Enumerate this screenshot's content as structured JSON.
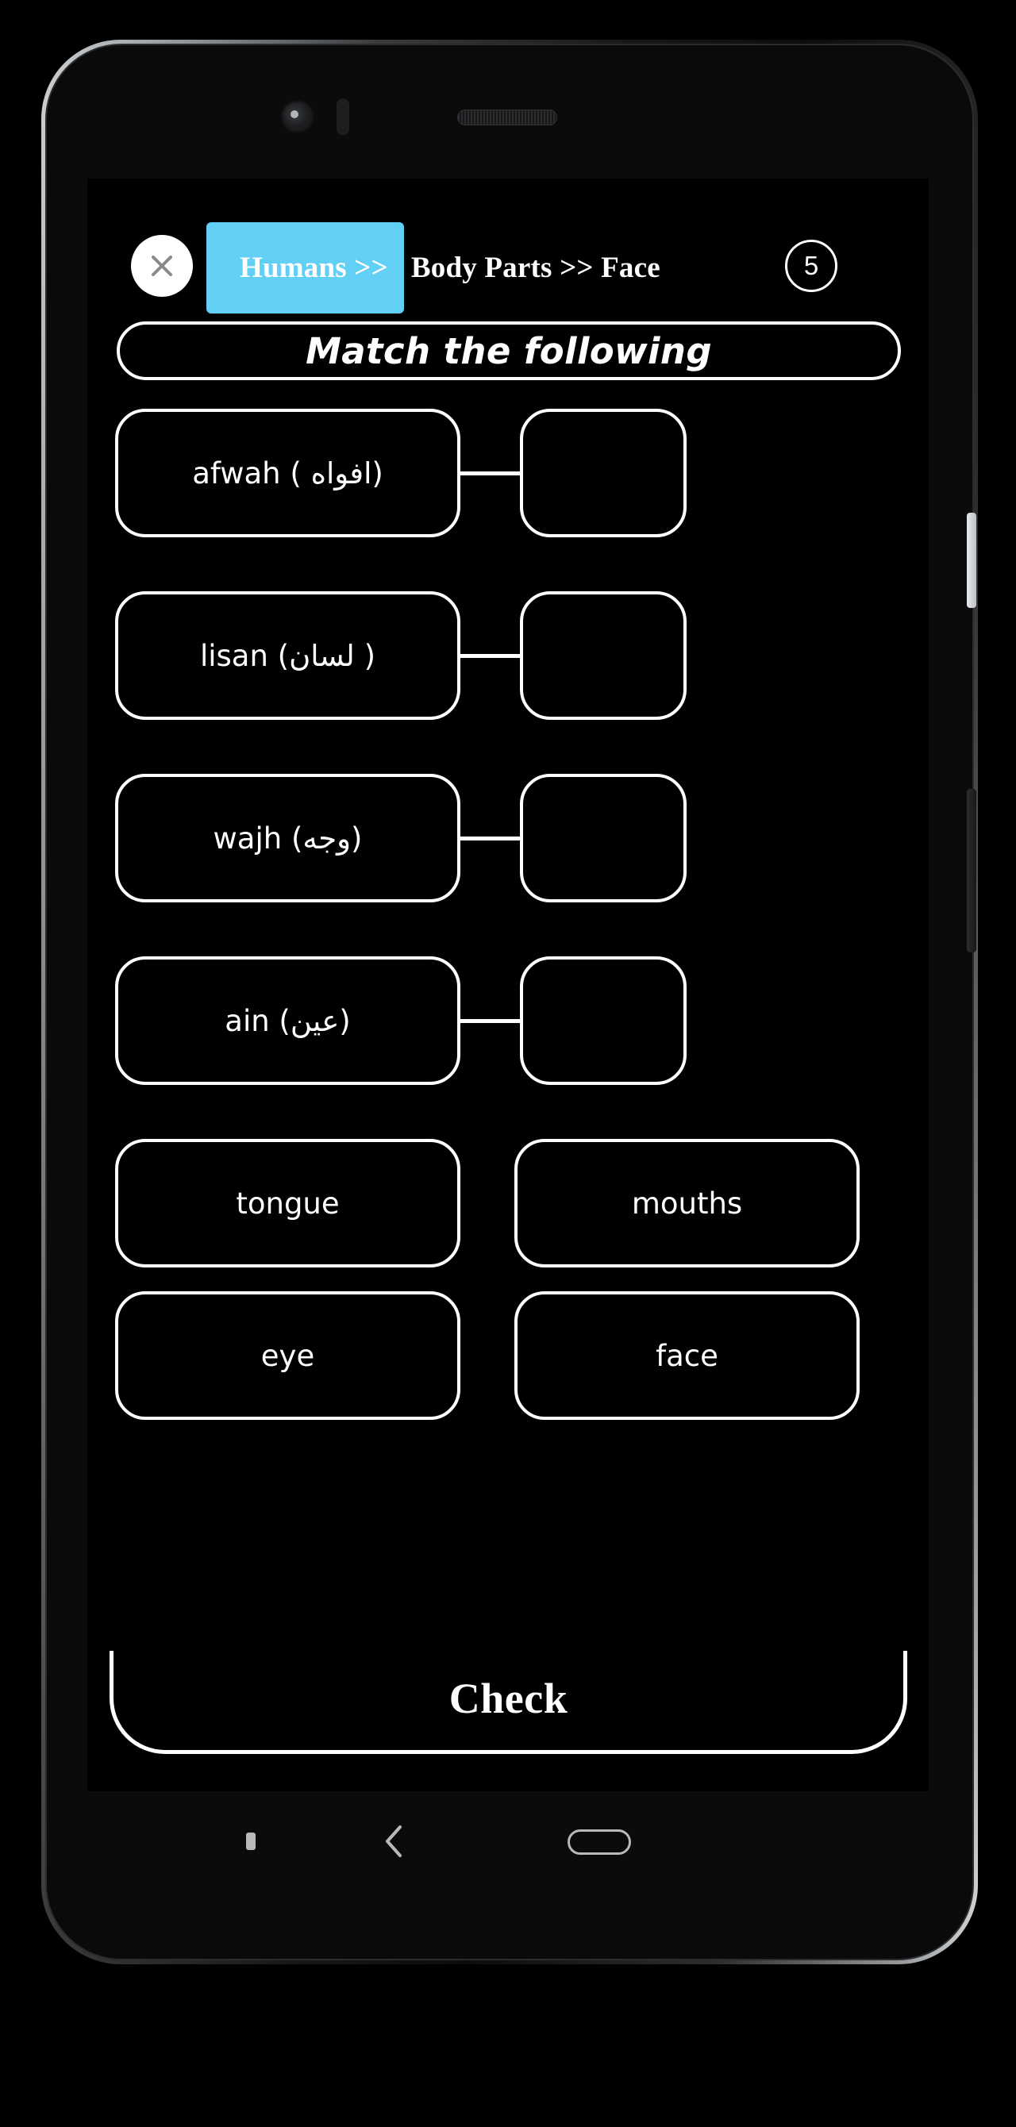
{
  "app": {
    "screen_title": "Match the following",
    "question_counter": "5",
    "close_icon": "close-x-icon"
  },
  "breadcrumb": {
    "active": "Humans >>",
    "rest": "Body Parts >> Face",
    "active_color": "#62cff5"
  },
  "match_rows": [
    {
      "term": "afwah ( افواه)",
      "answer": ""
    },
    {
      "term": "lisan (لسان )",
      "answer": ""
    },
    {
      "term": "wajh (وجه)",
      "answer": ""
    },
    {
      "term": "ain (عين)",
      "answer": ""
    }
  ],
  "options": [
    {
      "label": "tongue"
    },
    {
      "label": "mouths"
    },
    {
      "label": "eye"
    },
    {
      "label": "face"
    }
  ],
  "actions": {
    "check_label": "Check"
  },
  "nav_bar": {
    "recents_icon": "recents-square-icon",
    "back_icon": "back-chevron-icon",
    "home_icon": "home-pill-icon"
  },
  "theme": {
    "background": "#000000",
    "foreground": "#ffffff",
    "accent": "#62cff5"
  }
}
